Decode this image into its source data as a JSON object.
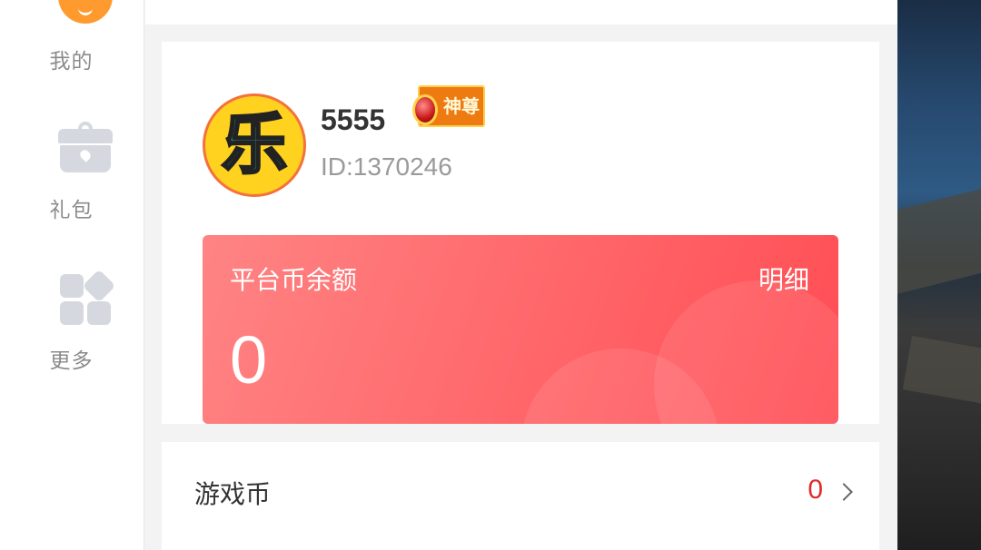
{
  "sidebar": {
    "items": [
      {
        "label": "我的",
        "icon": "profile-icon"
      },
      {
        "label": "礼包",
        "icon": "gift-icon"
      },
      {
        "label": "更多",
        "icon": "more-icon"
      }
    ]
  },
  "profile": {
    "username": "5555",
    "badge": "神尊",
    "id_text": "ID:1370246"
  },
  "balance": {
    "title": "平台币余额",
    "detail_link": "明细",
    "value": "0"
  },
  "game_coin": {
    "label": "游戏币",
    "value": "0"
  },
  "colors": {
    "accent_red": "#ff5a5f",
    "coin_value_red": "#e02a2a",
    "profile_orange": "#ff9a2e"
  }
}
